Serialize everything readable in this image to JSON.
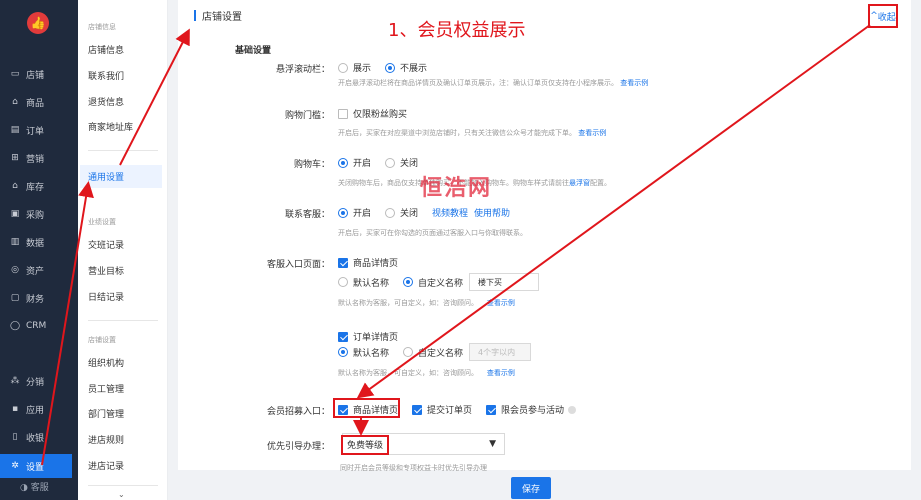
{
  "rail": {
    "items": [
      {
        "icon": "store-icon",
        "glyph": "▭",
        "label": "店铺"
      },
      {
        "icon": "goods-icon",
        "glyph": "⌂",
        "label": "商品"
      },
      {
        "icon": "order-icon",
        "glyph": "▤",
        "label": "订单"
      },
      {
        "icon": "marketing-icon",
        "glyph": "⊞",
        "label": "营销"
      },
      {
        "icon": "inventory-icon",
        "glyph": "⌂",
        "label": "库存"
      },
      {
        "icon": "purchase-icon",
        "glyph": "▣",
        "label": "采购"
      },
      {
        "icon": "data-icon",
        "glyph": "▥",
        "label": "数据"
      },
      {
        "icon": "assets-icon",
        "glyph": "◎",
        "label": "资产"
      },
      {
        "icon": "finance-icon",
        "glyph": "▢",
        "label": "财务"
      },
      {
        "icon": "crm-icon",
        "glyph": "◯",
        "label": "CRM"
      },
      {
        "icon": "distribution-icon",
        "glyph": "⁂",
        "label": "分销"
      },
      {
        "icon": "apps-icon",
        "glyph": "▪",
        "label": "应用"
      },
      {
        "icon": "cashier-icon",
        "glyph": "▯",
        "label": "收银"
      },
      {
        "icon": "settings-icon",
        "glyph": "✲",
        "label": "设置"
      }
    ],
    "bottom_label": "客服"
  },
  "submenu": {
    "group1": "店铺信息",
    "items1": [
      "店铺信息",
      "联系我们",
      "退货信息",
      "商家地址库"
    ],
    "active": "通用设置",
    "group2": "业绩设置",
    "items2": [
      "交班记录",
      "营业目标",
      "日结记录"
    ],
    "group3": "店铺设置",
    "items3": [
      "组织机构",
      "员工管理",
      "部门管理",
      "进店规则",
      "进店记录"
    ]
  },
  "card": {
    "title": "店铺设置",
    "collapse": "收起",
    "section": "基础设置"
  },
  "annotation": "1、会员权益展示",
  "watermark": "恒浩网",
  "form": {
    "float_bar": {
      "label": "悬浮滚动栏：",
      "opt_show": "展示",
      "opt_hide": "不展示",
      "help": "开启悬浮滚动栏将在商品详情页及确认订单页展示，注：确认订单页仅支持在小程序展示。",
      "link": "查看示例"
    },
    "threshold": {
      "label": "购物门槛：",
      "check": "仅限粉丝购买",
      "help": "开启后，买家在对应渠道中浏览店铺时，只有关注微信公众号才能完成下单。",
      "link": "查看示例"
    },
    "cart": {
      "label": "购物车：",
      "opt_on": "开启",
      "opt_off": "关闭",
      "help_pre": "关闭购物车后，商品仅支持单独购买，不能加入购物车。购物车样式请前往",
      "help_link": "悬浮窗",
      "help_post": "配置。"
    },
    "service": {
      "label": "联系客服：",
      "opt_on": "开启",
      "opt_off": "关闭",
      "link1": "视频教程",
      "link2": "使用帮助",
      "help": "开启后，买家可在你勾选的页面通过客服入口与你取得联系。"
    },
    "entry": {
      "label": "客服入口页面：",
      "page1": "商品详情页",
      "default_name": "默认名称",
      "custom_name": "自定义名称",
      "custom_value": "楼下买",
      "help": "默认名称为客服，可自定义，如：咨询顾问。",
      "link": "查看示例",
      "page2": "订单详情页",
      "default_name2": "默认名称",
      "custom_name2": "自定义名称",
      "custom_placeholder2": "4个字以内",
      "help2": "默认名称为客服，可自定义，如：咨询顾问。",
      "link2": "查看示例"
    },
    "member": {
      "label": "会员招募入口：",
      "opt1": "商品详情页",
      "opt2": "提交订单页",
      "opt3": "限会员参与活动"
    },
    "priority": {
      "label": "优先引导办理：",
      "value": "免费等级",
      "help": "同时开启会员等级和专项权益卡时优先引导办理"
    }
  },
  "save_label": "保存",
  "colors": {
    "accent": "#1a74e8",
    "annotation": "#e0161c",
    "rail": "#1f2a3d"
  }
}
